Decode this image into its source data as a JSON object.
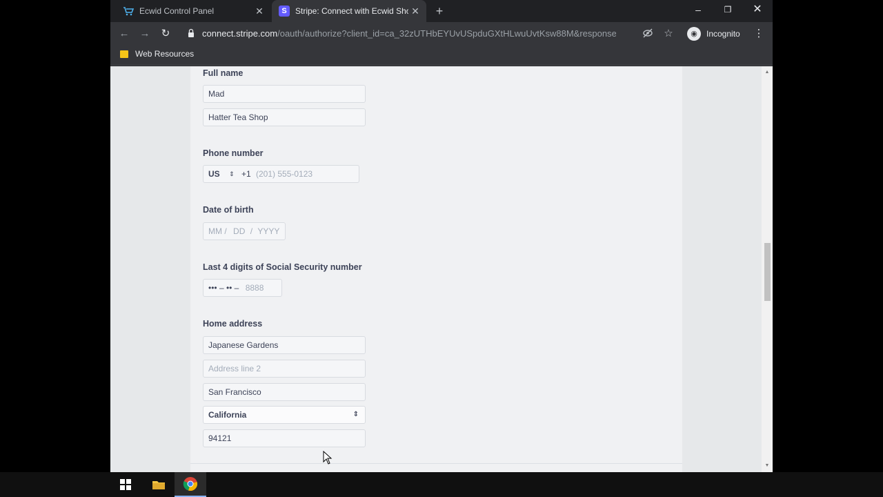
{
  "browser": {
    "tabs": [
      {
        "title": "Ecwid Control Panel",
        "active": false,
        "icon": "ecwid-cart-icon"
      },
      {
        "title": "Stripe: Connect with Ecwid Shopping Cart",
        "active": true,
        "icon": "stripe-icon"
      }
    ],
    "url_host": "connect.stripe.com",
    "url_path": "/oauth/authorize?client_id=ca_32zUTHbEYUvUSpduGXtHLwuUvtKsw88M&response_typ...",
    "profile_label": "Incognito",
    "bookmark_folder": "Web Resources"
  },
  "form": {
    "full_name": {
      "label": "Full name",
      "first": "Mad",
      "last": "Hatter Tea Shop"
    },
    "phone": {
      "label": "Phone number",
      "country": "US",
      "prefix": "+1",
      "placeholder": "(201) 555-0123"
    },
    "dob": {
      "label": "Date of birth",
      "mm": "MM",
      "dd": "DD",
      "yyyy": "YYYY",
      "sep": "/"
    },
    "ssn": {
      "label": "Last 4 digits of Social Security number",
      "mask": "••• – •• –",
      "placeholder": "8888"
    },
    "address": {
      "label": "Home address",
      "line1": "Japanese Gardens",
      "line2_placeholder": "Address line 2",
      "city": "San Francisco",
      "state": "California",
      "zip": "94121"
    }
  },
  "colors": {
    "stripe_brand": "#635bff",
    "chrome_dark": "#202124",
    "chrome_toolbar": "#35363a"
  }
}
